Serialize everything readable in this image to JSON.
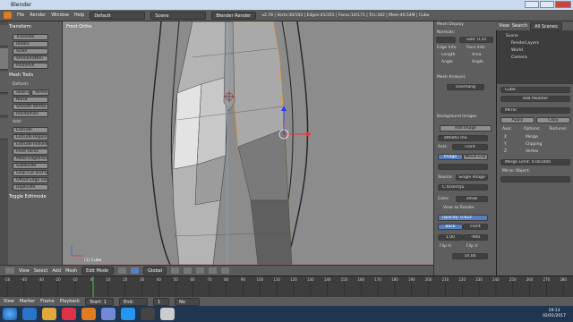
{
  "window": {
    "title": "Blender"
  },
  "info_header": {
    "menus": [
      "File",
      "Render",
      "Window",
      "Help"
    ],
    "layout": "Default",
    "scene": "Scene",
    "engine": "Blender Render",
    "stats": "v2.78 | Verts:30/193 | Edges:41/355 | Faces:14/171 | Tris:342 | Mem:49.54M | Cube"
  },
  "toolshelf": {
    "transform_header": "Transform",
    "transform": [
      "Translate",
      "Rotate",
      "Scale",
      "Shrink/Fatten",
      "Push/Pull"
    ],
    "mesh_tools_header": "Mesh Tools",
    "deform_label": "Deform:",
    "slide_edge": "Slide Ed",
    "vertex": "Vertex",
    "noise": "Noise",
    "smooth_vertex": "Smooth Vertex",
    "randomize": "Randomize",
    "add_label": "Add:",
    "add_tools": [
      "Extrude",
      "Extrude Region",
      "Extrude Individual",
      "Inset Faces",
      "Make Edge/Face",
      "Subdivide",
      "Loop Cut and Slide",
      "Offset Edge Slide",
      "Duplicate"
    ],
    "toggle": "Toggle Editmode"
  },
  "viewport": {
    "view_label": "Front Ortho",
    "object_label": "(1) Cube",
    "header_menus": [
      "View",
      "Select",
      "Add",
      "Mesh"
    ],
    "mode": "Edit Mode",
    "pivot": "Global"
  },
  "properties_panel": {
    "mesh_display": "Mesh Display",
    "normals": "Normals:",
    "size_label": "Size:",
    "size_value": "0.10",
    "edge_info": "Edge Info:",
    "face_info": "Face Info:",
    "length": "Length",
    "area": "Area",
    "angle": "Angle",
    "angle2": "Angle",
    "mesh_analysis": "Mesh Analysis",
    "overhang": "Overhang",
    "background_images": "Background Images",
    "add_image": "Add Image",
    "image_name": "athletic.ma",
    "axis_label": "Axis:",
    "axis_value": "Front",
    "image_tab": "Image",
    "movie_clip_tab": "Movie Clip",
    "source_label": "Source:",
    "source_value": "Single Image",
    "path": "C:\\Users\\Ju",
    "color_label": "Color:",
    "color_value": "sRGB",
    "view_as_render": "View as Render",
    "opacity_label": "Opacity:",
    "opacity_value": "0.622",
    "back": "Back",
    "front": "Front",
    "x_value": "1.00",
    "y_value": "-900",
    "flip_h": "Flip H",
    "flip_v": "Flip V",
    "rot_value": "10.00"
  },
  "outliner": {
    "view": "View",
    "search": "Search",
    "scenes": "All Scenes",
    "items": [
      "Scene",
      "RenderLayers",
      "World",
      "Camera"
    ]
  },
  "modifier_panel": {
    "object": "Cube",
    "add_modifier": "Add Modifier",
    "mirror_label": "Mirror",
    "apply": "Apply",
    "copy": "Copy",
    "axis_header": "Axis:",
    "options_header": "Options:",
    "textures_header": "Textures:",
    "axes": [
      "X",
      "Y",
      "Z"
    ],
    "options": [
      "Merge",
      "Clipping",
      "Vertex"
    ],
    "merge_limit_label": "Merge Limit:",
    "merge_limit_value": "0.001000",
    "mirror_object": "Mirror Object:"
  },
  "timeline": {
    "ticks": [
      "-50",
      "-40",
      "-30",
      "-20",
      "-10",
      "0",
      "10",
      "20",
      "30",
      "40",
      "50",
      "60",
      "70",
      "80",
      "90",
      "100",
      "110",
      "120",
      "130",
      "140",
      "150",
      "160",
      "170",
      "180",
      "190",
      "200",
      "210",
      "220",
      "230",
      "240",
      "250",
      "260",
      "270",
      "280"
    ],
    "menus": [
      "View",
      "Marker",
      "Frame",
      "Playback"
    ],
    "start_label": "Start:",
    "start_value": "1",
    "end_label": "End:",
    "end_value": "250",
    "frame_value": "1",
    "sync": "No Sync"
  },
  "taskbar": {
    "time": "19:13",
    "date": "02/01/2017"
  },
  "colors": {
    "accent": "#5680c2",
    "selection": "#f39c2a"
  }
}
